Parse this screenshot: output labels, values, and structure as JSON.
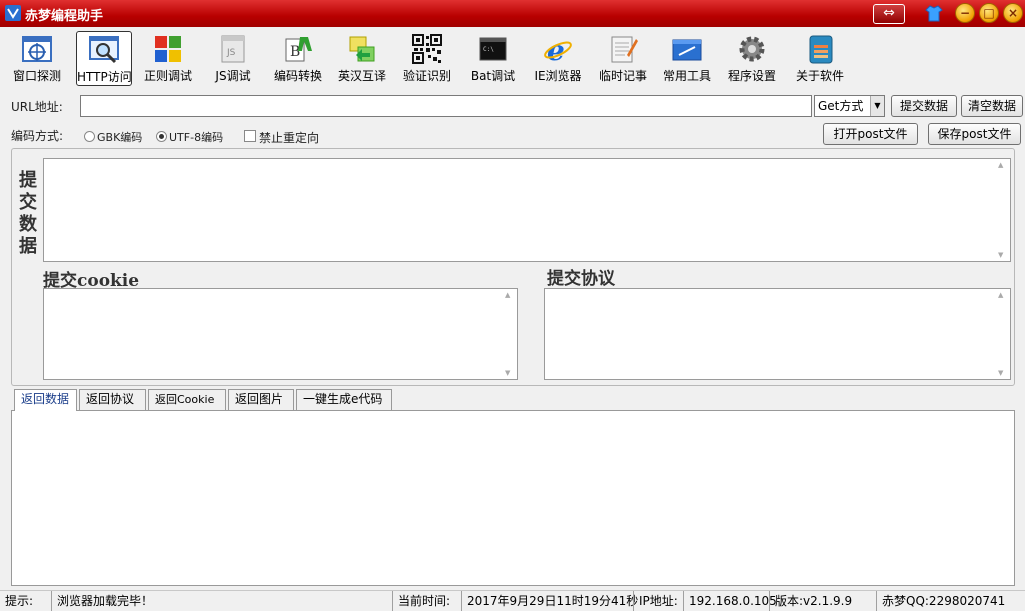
{
  "app": {
    "title": "赤梦编程助手"
  },
  "titlebar": {
    "swap_glyph": "⇔",
    "min_glyph": "−",
    "max_glyph": "□",
    "close_glyph": "×"
  },
  "toolbar": {
    "items": [
      {
        "label": "窗口探测",
        "icon": "window-probe-icon"
      },
      {
        "label": "HTTP访问",
        "icon": "http-access-icon"
      },
      {
        "label": "正则调试",
        "icon": "regex-debug-icon"
      },
      {
        "label": "JS调试",
        "icon": "js-debug-icon"
      },
      {
        "label": "编码转换",
        "icon": "encoding-convert-icon"
      },
      {
        "label": "英汉互译",
        "icon": "translate-icon"
      },
      {
        "label": "验证识别",
        "icon": "qrcode-icon"
      },
      {
        "label": "Bat调试",
        "icon": "bat-debug-icon"
      },
      {
        "label": "IE浏览器",
        "icon": "ie-browser-icon"
      },
      {
        "label": "临时记事",
        "icon": "notepad-icon"
      },
      {
        "label": "常用工具",
        "icon": "tools-icon"
      },
      {
        "label": "程序设置",
        "icon": "settings-gear-icon"
      },
      {
        "label": "关于软件",
        "icon": "about-icon"
      }
    ]
  },
  "request": {
    "url_label": "URL地址:",
    "url_value": "",
    "method_value": "Get方式",
    "submit_label": "提交数据",
    "clear_label": "清空数据",
    "encoding_label": "编码方式:",
    "gbk_label": "GBK编码",
    "utf8_label": "UTF-8编码",
    "no_redirect_label": "禁止重定向",
    "open_post_label": "打开post文件",
    "save_post_label": "保存post文件"
  },
  "panels": {
    "submit_data_label": "提交数据",
    "submit_cookie_label": "提交cookie",
    "submit_protocol_label": "提交协议"
  },
  "tabs": [
    {
      "label": "返回数据",
      "active": true
    },
    {
      "label": "返回协议",
      "active": false
    },
    {
      "label": "返回Cookie",
      "active": false
    },
    {
      "label": "返回图片",
      "active": false
    },
    {
      "label": "一键生成e代码",
      "active": false
    }
  ],
  "status": {
    "hint_label": "提示:",
    "hint_value": "浏览器加载完毕！",
    "time_label": "当前时间:",
    "time_value": "2017年9月29日11时19分41秒",
    "ip_label": "IP地址:",
    "ip_value": "192.168.0.105",
    "version_value": "版本:v2.1.9.9",
    "qq_value": "赤梦QQ:2298020741"
  }
}
